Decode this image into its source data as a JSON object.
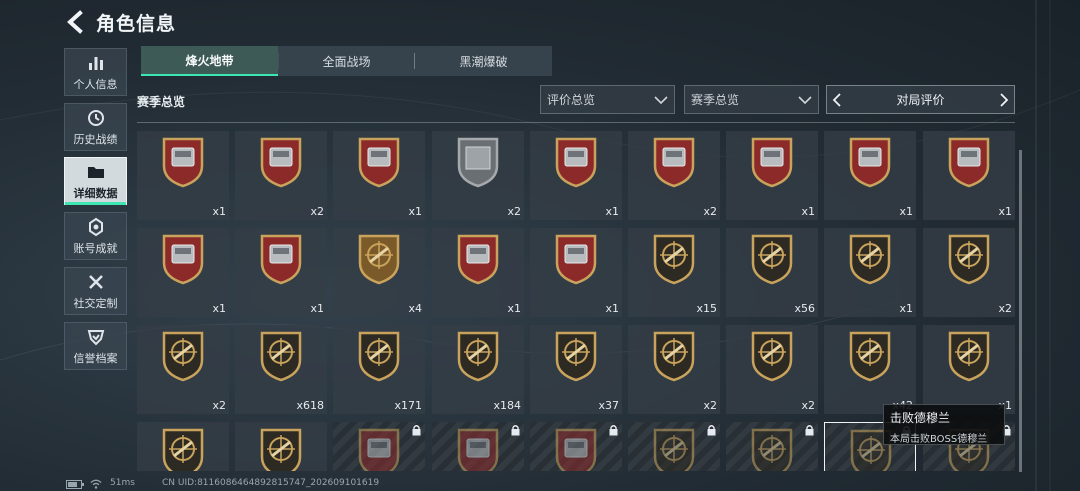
{
  "header": {
    "title": "角色信息",
    "back_icon": "back-arrow-icon"
  },
  "nav": [
    {
      "label": "个人信息",
      "icon": "bar-chart-icon",
      "active": false
    },
    {
      "label": "历史战绩",
      "icon": "history-icon",
      "active": false
    },
    {
      "label": "详细数据",
      "icon": "folder-icon",
      "active": true
    },
    {
      "label": "账号成就",
      "icon": "achievement-icon",
      "active": false
    },
    {
      "label": "社交定制",
      "icon": "tools-icon",
      "active": false
    },
    {
      "label": "信誉档案",
      "icon": "shield-check-icon",
      "active": false
    }
  ],
  "tabs": [
    {
      "label": "烽火地带",
      "active": true
    },
    {
      "label": "全面战场",
      "active": false
    },
    {
      "label": "黑潮爆破",
      "active": false
    }
  ],
  "section_label": "赛季总览",
  "filters": {
    "rating_overview": "评价总览",
    "season_overview": "赛季总览",
    "match_rating": "对局评价"
  },
  "badges": [
    {
      "kind": "red",
      "item": "tank",
      "count": "x1"
    },
    {
      "kind": "red",
      "item": "computer",
      "count": "x2"
    },
    {
      "kind": "red",
      "item": "panel",
      "count": "x1"
    },
    {
      "kind": "plate",
      "item": "plate",
      "count": "x2"
    },
    {
      "kind": "red",
      "item": "server",
      "count": "x1"
    },
    {
      "kind": "red",
      "item": "console",
      "count": "x2"
    },
    {
      "kind": "red",
      "item": "machine",
      "count": "x1"
    },
    {
      "kind": "red",
      "item": "reactor",
      "count": "x1"
    },
    {
      "kind": "red",
      "item": "helmet",
      "count": "x1"
    },
    {
      "kind": "red",
      "item": "chess",
      "count": "x1"
    },
    {
      "kind": "red",
      "item": "drone",
      "count": "x1"
    },
    {
      "kind": "gold",
      "item": "painting",
      "count": "x4"
    },
    {
      "kind": "red",
      "item": "capsule",
      "count": "x1"
    },
    {
      "kind": "red",
      "item": "robot",
      "count": "x1"
    },
    {
      "kind": "gold-emblem",
      "item": "rifle",
      "count": "x15"
    },
    {
      "kind": "gold-emblem",
      "item": "smg",
      "count": "x56"
    },
    {
      "kind": "gold-emblem",
      "item": "sniper",
      "count": "x1"
    },
    {
      "kind": "gold-emblem",
      "item": "shotgun",
      "count": "x2"
    },
    {
      "kind": "gold-emblem",
      "item": "pistol",
      "count": "x2"
    },
    {
      "kind": "gold-emblem",
      "item": "knife",
      "count": "x618"
    },
    {
      "kind": "gold-emblem",
      "item": "explosion",
      "count": "x171"
    },
    {
      "kind": "gold-emblem",
      "item": "medal",
      "count": "x184"
    },
    {
      "kind": "gold-emblem",
      "item": "wreath",
      "count": "x37"
    },
    {
      "kind": "gold-emblem",
      "item": "soldier",
      "count": "x2"
    },
    {
      "kind": "gold-emblem",
      "item": "officer",
      "count": "x2"
    },
    {
      "kind": "gold-emblem",
      "item": "helmet-face",
      "count": "x42"
    },
    {
      "kind": "gold-emblem",
      "item": "mask-face",
      "count": "x1"
    },
    {
      "kind": "gold-emblem",
      "item": "head",
      "count": ""
    },
    {
      "kind": "gold-emblem",
      "item": "head2",
      "count": ""
    },
    {
      "kind": "locked-red",
      "item": "rock",
      "count": "",
      "locked": true
    },
    {
      "kind": "locked-red",
      "item": "globe",
      "count": "",
      "locked": true
    },
    {
      "kind": "locked-red",
      "item": "fish",
      "count": "",
      "locked": true
    },
    {
      "kind": "locked-emblem",
      "item": "rifle",
      "count": "",
      "locked": true
    },
    {
      "kind": "locked-emblem",
      "item": "smg",
      "count": "",
      "locked": true
    },
    {
      "kind": "locked-emblem",
      "item": "boss",
      "count": "",
      "locked": true,
      "selected": true
    },
    {
      "kind": "locked-emblem",
      "item": "boss2",
      "count": "",
      "locked": true
    }
  ],
  "tooltip": {
    "title": "击败德穆兰",
    "desc": "本局击败BOSS德穆兰"
  },
  "status": {
    "ping": "51ms",
    "uid": "CN UID:8116086464892815747_202609101619"
  },
  "colors": {
    "accent": "#3ee6b2",
    "badge_red": "#8c2a2a",
    "badge_gold": "#c9a35c"
  }
}
